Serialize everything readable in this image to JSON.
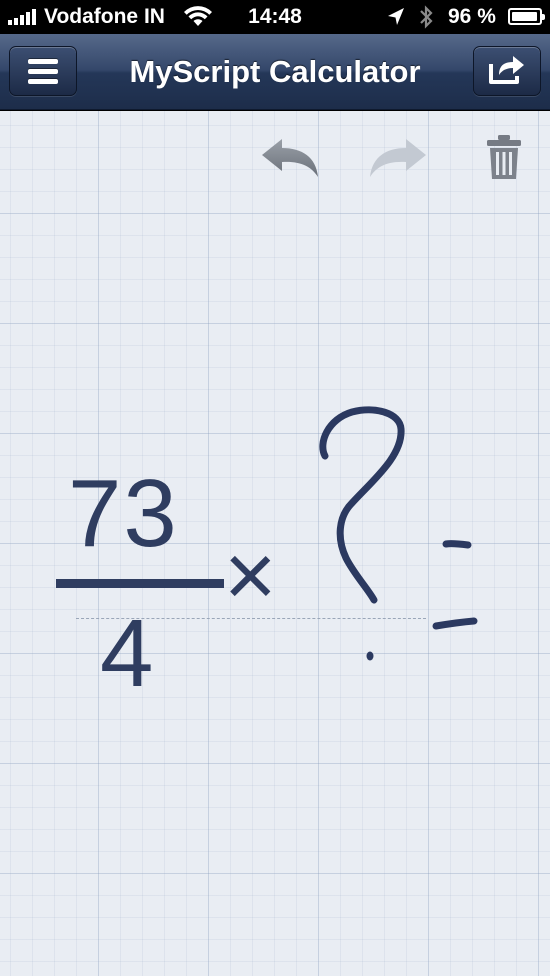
{
  "status_bar": {
    "carrier": "Vodafone IN",
    "time": "14:48",
    "battery_percent": "96 %",
    "battery_level": 0.96
  },
  "navbar": {
    "title": "MyScript Calculator",
    "menu_icon": "hamburger-menu-icon",
    "share_icon": "share-export-icon"
  },
  "toolbar": {
    "undo_icon": "undo-arrow-icon",
    "redo_icon": "redo-arrow-icon",
    "redo_enabled": false,
    "trash_icon": "trash-icon"
  },
  "expression": {
    "numerator": "73",
    "denominator": "4",
    "operator": "×",
    "handwritten": "?="
  },
  "colors": {
    "ink": "#2f3d60",
    "nav_bg": "#2a3c5e",
    "canvas_bg": "#e9edf3",
    "icon_active": "#7a7f88",
    "icon_disabled": "#bfc6d0"
  }
}
